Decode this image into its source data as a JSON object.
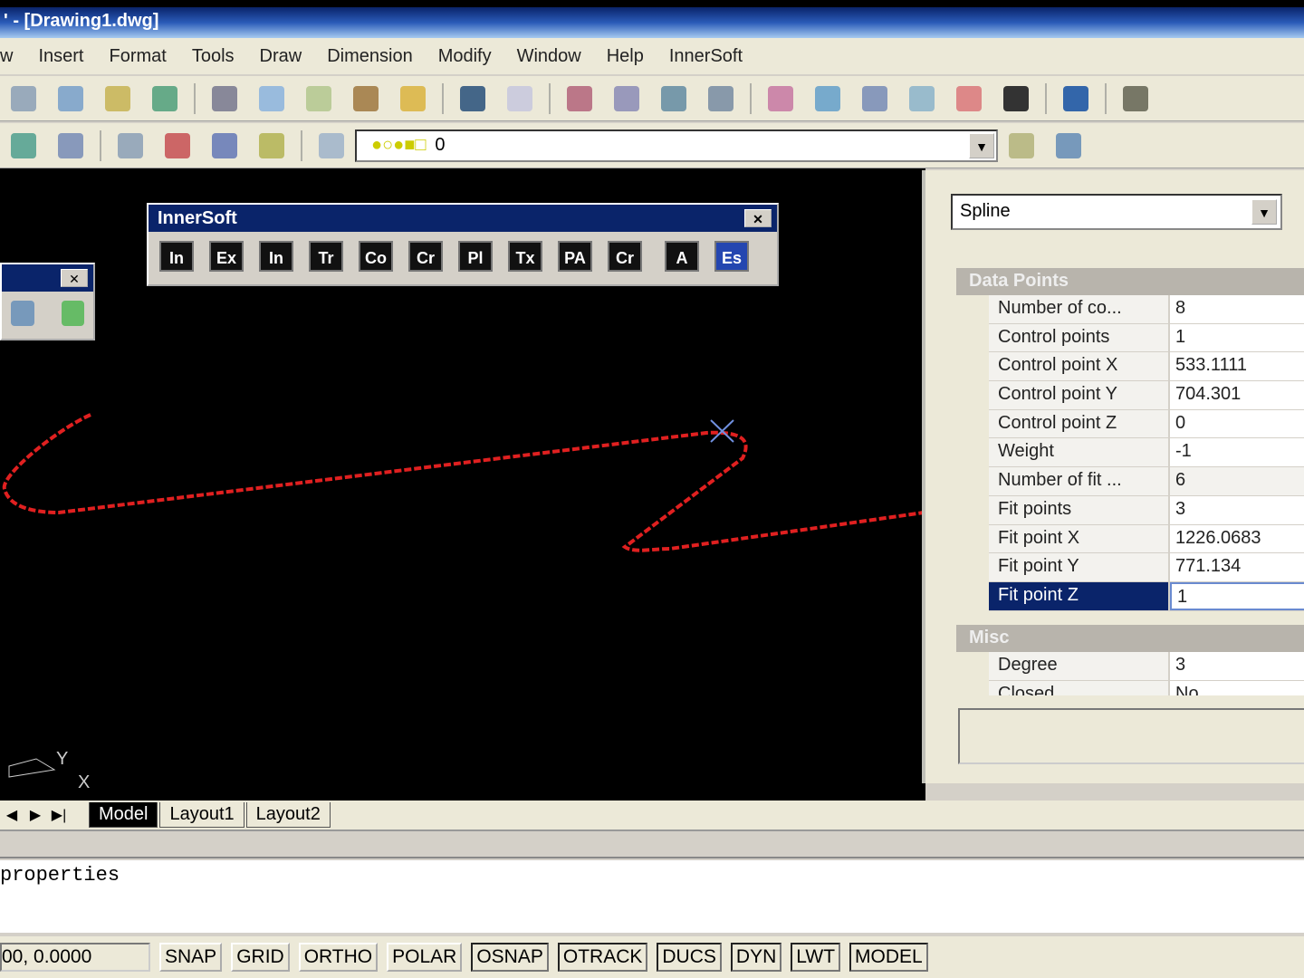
{
  "title": "' - [Drawing1.dwg]",
  "menu": [
    "w",
    "Insert",
    "Format",
    "Tools",
    "Draw",
    "Dimension",
    "Modify",
    "Window",
    "Help",
    "InnerSoft"
  ],
  "layer": {
    "value": "0"
  },
  "innersoft": {
    "title": "InnerSoft",
    "buttons": [
      "In",
      "Ex",
      "In",
      "Tr",
      "Co",
      "Cr",
      "Pl",
      "Tx",
      "PA",
      "Cr",
      "A",
      "Es"
    ]
  },
  "ucs": {
    "x": "X",
    "y": "Y"
  },
  "properties": {
    "object_type": "Spline",
    "categories": [
      {
        "name": "Data Points",
        "rows": [
          {
            "label": "Number of co...",
            "value": "8"
          },
          {
            "label": "Control points",
            "value": "1"
          },
          {
            "label": "Control point X",
            "value": "533.1111"
          },
          {
            "label": "Control point Y",
            "value": "704.301"
          },
          {
            "label": "Control point Z",
            "value": "0"
          },
          {
            "label": "Weight",
            "value": "-1"
          },
          {
            "label": "Number of fit ...",
            "value": "6"
          },
          {
            "label": "Fit points",
            "value": "3"
          },
          {
            "label": "Fit point X",
            "value": "1226.0683"
          },
          {
            "label": "Fit point Y",
            "value": "771.134"
          },
          {
            "label": "Fit point Z",
            "value": "1"
          }
        ]
      },
      {
        "name": "Misc",
        "rows": [
          {
            "label": "Degree",
            "value": "3"
          },
          {
            "label": "Closed",
            "value": "No"
          }
        ]
      }
    ]
  },
  "tabs": [
    "Model",
    "Layout1",
    "Layout2"
  ],
  "command": {
    "line": "properties"
  },
  "status": {
    "coords": "00, 0.0000",
    "buttons": [
      "SNAP",
      "GRID",
      "ORTHO",
      "POLAR",
      "OSNAP",
      "OTRACK",
      "DUCS",
      "DYN",
      "LWT",
      "MODEL"
    ],
    "on": [
      "OSNAP",
      "OTRACK",
      "DUCS",
      "DYN",
      "LWT",
      "MODEL"
    ]
  }
}
